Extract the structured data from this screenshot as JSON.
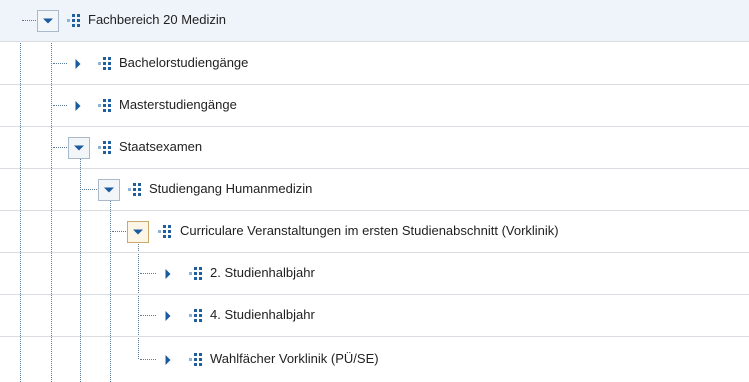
{
  "tree": {
    "nodes": [
      {
        "label": "Fachbereich 20 Medizin",
        "state": "expanded",
        "icon": "org-unit-icon",
        "toggle_icon": "chevron-down-icon"
      },
      {
        "label": "Bachelorstudiengänge",
        "state": "collapsed",
        "icon": "org-unit-icon",
        "toggle_icon": "chevron-right-icon"
      },
      {
        "label": "Masterstudiengänge",
        "state": "collapsed",
        "icon": "org-unit-icon",
        "toggle_icon": "chevron-right-icon"
      },
      {
        "label": "Staatsexamen",
        "state": "expanded",
        "icon": "org-unit-icon",
        "toggle_icon": "chevron-down-icon"
      },
      {
        "label": "Studiengang Humanmedizin",
        "state": "expanded",
        "icon": "org-unit-icon",
        "toggle_icon": "chevron-down-icon"
      },
      {
        "label": "Curriculare Veranstaltungen im ersten Studienabschnitt (Vorklinik)",
        "state": "expanded",
        "icon": "org-unit-icon",
        "toggle_icon": "chevron-down-icon"
      },
      {
        "label": "2. Studienhalbjahr",
        "state": "collapsed",
        "icon": "org-unit-icon",
        "toggle_icon": "chevron-right-icon"
      },
      {
        "label": "4. Studienhalbjahr",
        "state": "collapsed",
        "icon": "org-unit-icon",
        "toggle_icon": "chevron-right-icon"
      },
      {
        "label": "Wahlfächer Vorklinik (PÜ/SE)",
        "state": "collapsed",
        "icon": "org-unit-icon",
        "toggle_icon": "chevron-right-icon"
      }
    ]
  },
  "colors": {
    "toggle_blue": "#1a5a9e",
    "icon_blue": "#1f5f9f",
    "icon_light_blue": "#8fb3d6",
    "row_selected_bg": "#eef4fa",
    "row_border": "#d9dde2",
    "connector_line": "#5b7a97"
  }
}
